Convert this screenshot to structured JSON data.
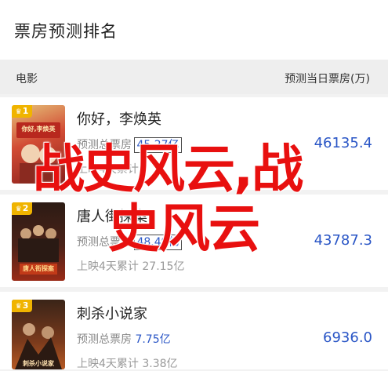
{
  "header": {
    "title": "票房预测排名"
  },
  "columns": {
    "left": "电影",
    "right": "预测当日票房(万)"
  },
  "movies": [
    {
      "rank": "1",
      "name": "你好，李焕英",
      "forecast_label": "预测总票房",
      "forecast_value": "45.27亿",
      "released_label": "上映4天累计",
      "released_value": "",
      "daily": "46135.4",
      "poster_title": "你好,李焕英",
      "poster_colors": [
        "#c9372c",
        "#e8c36a"
      ]
    },
    {
      "rank": "2",
      "name": "唐人街探案3",
      "forecast_label": "预测总票房",
      "forecast_value": "48.49亿",
      "released_label": "上映4天累计",
      "released_value": "27.15亿",
      "daily": "43787.3",
      "poster_title": "唐人街探案",
      "poster_colors": [
        "#1f1411",
        "#7a2418"
      ]
    },
    {
      "rank": "3",
      "name": "刺杀小说家",
      "forecast_label": "预测总票房",
      "forecast_value": "7.75亿",
      "released_label": "上映4天累计",
      "released_value": "3.38亿",
      "daily": "6936.0",
      "poster_title": "刺杀小说家",
      "poster_colors": [
        "#2a1a14",
        "#a14a22"
      ]
    }
  ],
  "watermark": {
    "line1": "战史风云,战",
    "line2": "史风云"
  },
  "colors": {
    "accent": "#2a56c6",
    "badge": "#f0b400",
    "watermark": "#e8100f"
  }
}
